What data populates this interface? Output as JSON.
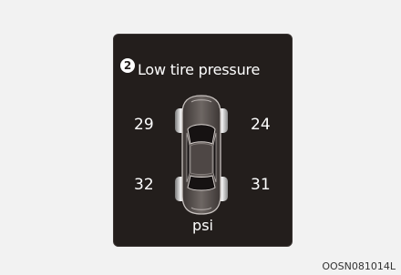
{
  "display": {
    "callout": "2",
    "title": "Low tire pressure",
    "tires": {
      "front_left": "29",
      "front_right": "24",
      "rear_left": "32",
      "rear_right": "31"
    },
    "unit": "psi"
  },
  "caption": "OOSN081014L",
  "icons": [
    "car-top-view-icon"
  ],
  "colors": {
    "screen_background": "#231e1c",
    "text": "#ffffff",
    "page_background": "#f2f2f2"
  }
}
